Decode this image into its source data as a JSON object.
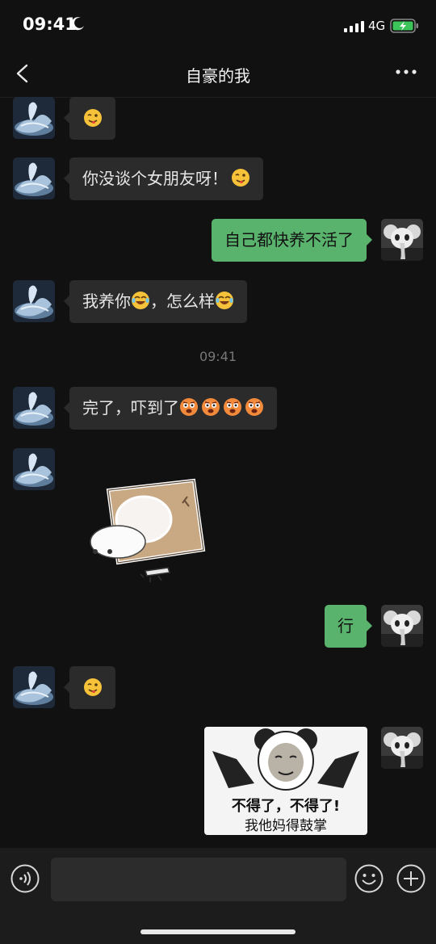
{
  "status_bar": {
    "time": "09:41",
    "network": "4G"
  },
  "header": {
    "title": "自豪的我"
  },
  "messages": [
    {
      "side": "in",
      "parts": [
        "",
        "wink"
      ]
    },
    {
      "side": "in",
      "text": "你没谈个女朋友呀！"
    },
    {
      "side": "out",
      "text": "自己都快养不活了"
    },
    {
      "side": "in",
      "text_a": "我养你",
      "text_b": "，怎么样"
    },
    {
      "side": "in",
      "text": "完了，吓到了"
    },
    {
      "side": "in",
      "type": "sticker"
    },
    {
      "side": "out",
      "text": "行"
    },
    {
      "side": "in",
      "type": "emoji"
    },
    {
      "side": "out",
      "type": "image",
      "caption_1": "不得了，不得了!",
      "caption_2": "我他妈得鼓掌"
    }
  ],
  "timestamp": "09:41",
  "input_bar": {
    "placeholder": ""
  },
  "colors": {
    "background": "#111111",
    "bubble_in": "#2b2b2b",
    "bubble_out": "#5ab36d"
  }
}
